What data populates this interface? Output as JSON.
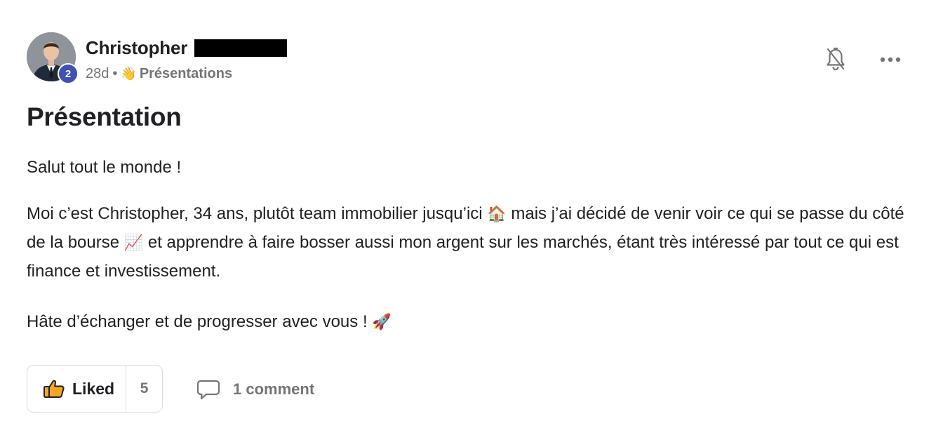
{
  "author": {
    "name": "Christopher",
    "level": "2"
  },
  "meta": {
    "time_ago": "28d",
    "separator": "•",
    "category_emoji": "👋",
    "category": "Présentations"
  },
  "post": {
    "title": "Présentation",
    "greeting": "Salut tout le monde !",
    "intro_part1": "Moi c’est Christopher, 34 ans, plutôt team immobilier jusqu’ici",
    "intro_emoji1": "🏠",
    "intro_part2": "mais j’ai décidé de venir voir ce qui se passe du côté de la bourse",
    "intro_emoji2": "📈",
    "intro_part3": "et apprendre à faire bosser aussi mon argent sur les marchés, étant très intéressé par tout ce qui est finance et investissement.",
    "outro": "Hâte d’échanger et de progresser avec vous !",
    "outro_emoji": "🚀"
  },
  "actions": {
    "like_label": "Liked",
    "like_count": "5",
    "comment_label": "1 comment"
  },
  "icons": {
    "bell": "bell-off-icon",
    "more": "more-horizontal-icon",
    "like": "thumbs-up-icon",
    "comment": "comment-icon"
  },
  "colors": {
    "level_badge": "#3f51b5",
    "like_icon": "#f5a623",
    "muted_text": "#757575",
    "primary_text": "#202124",
    "border": "#dadce0"
  }
}
